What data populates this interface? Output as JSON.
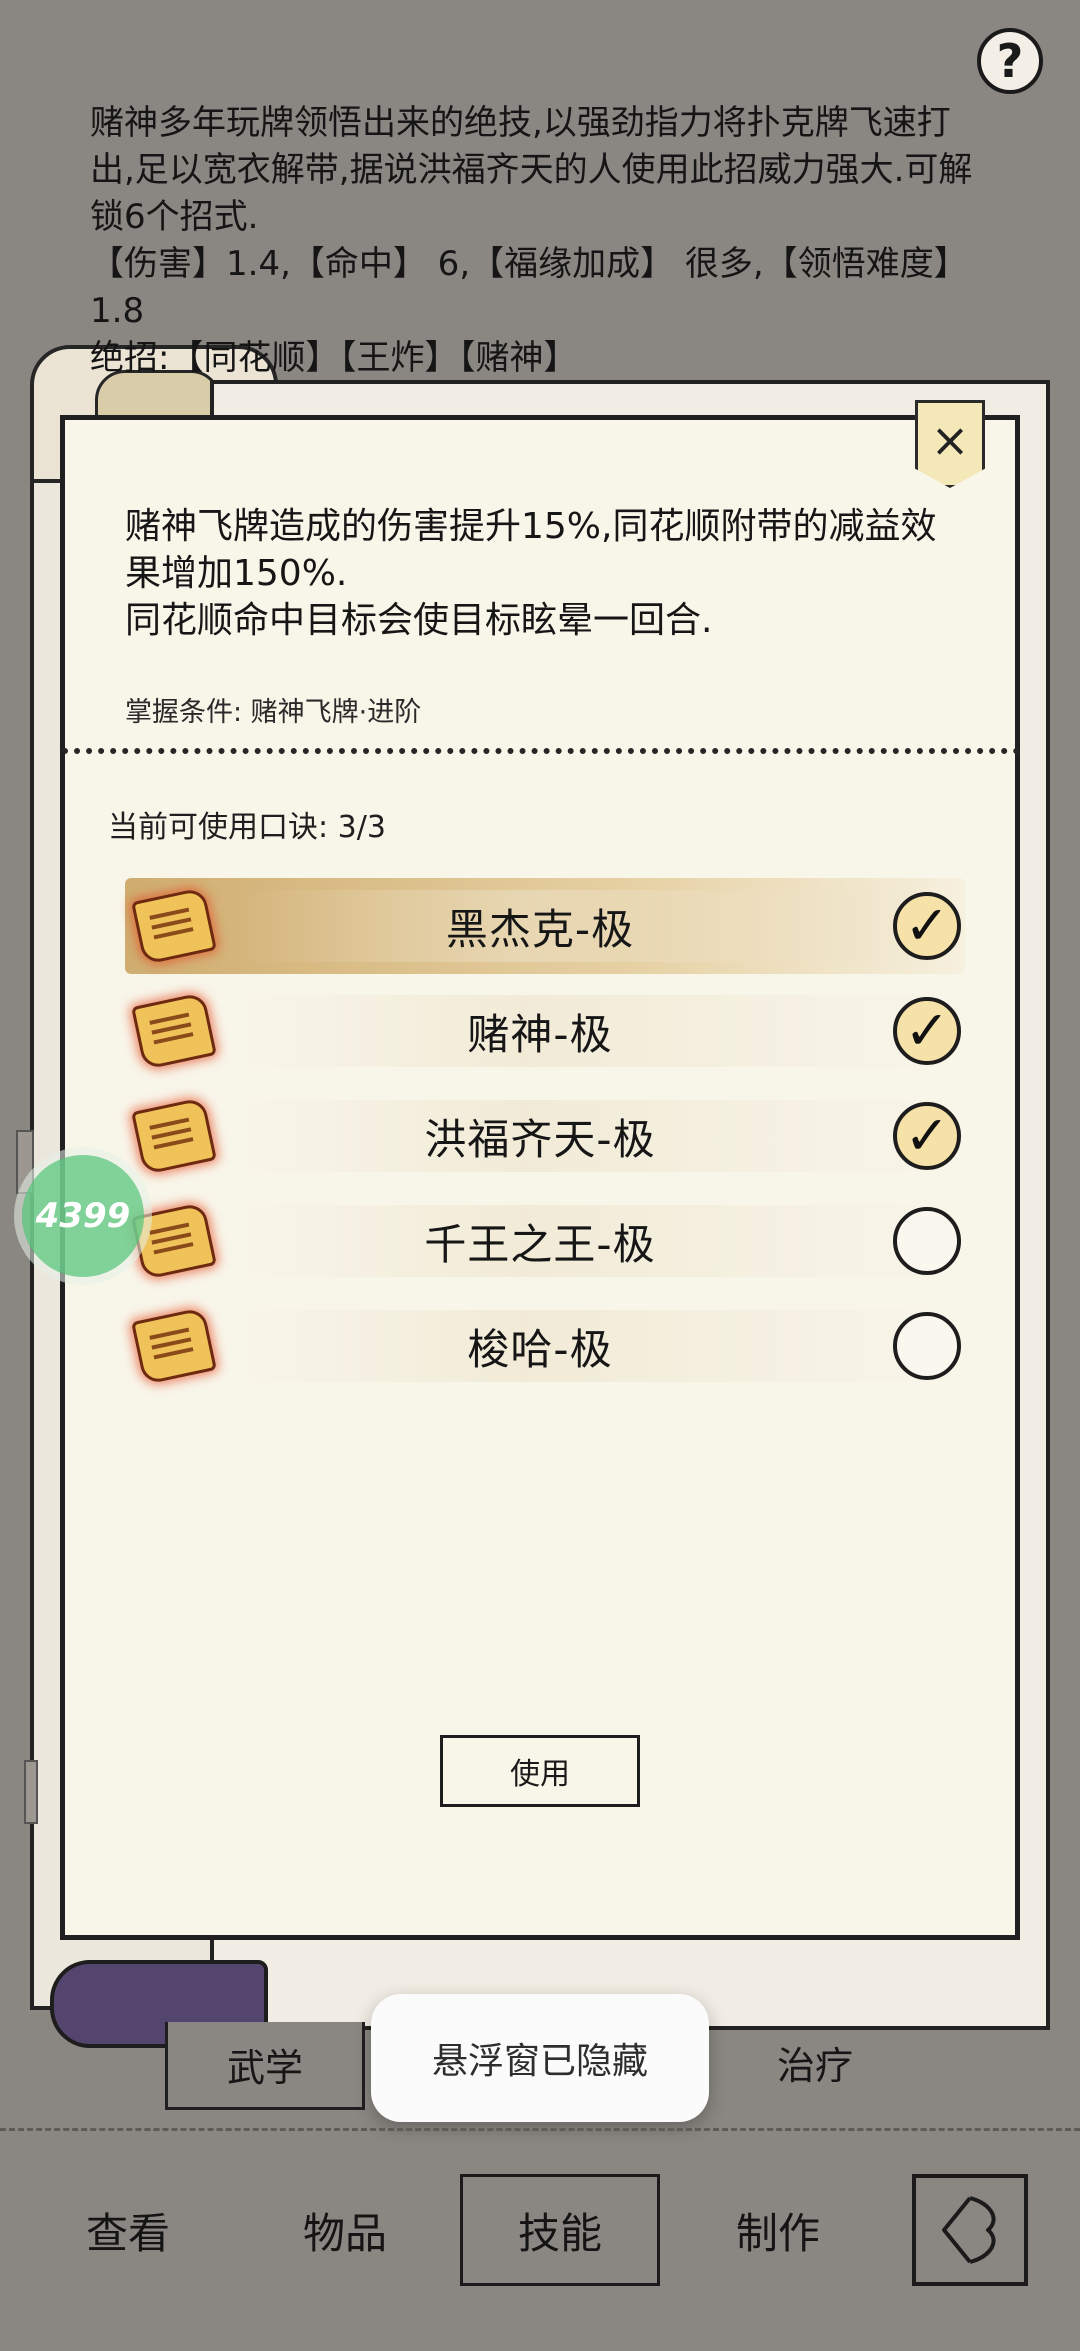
{
  "help": {
    "glyph": "?"
  },
  "skill": {
    "description": "赌神多年玩牌领悟出来的绝技,以强劲指力将扑克牌飞速打出,足以宽衣解带,据说洪福齐天的人使用此招威力强大.可解锁6个招式.",
    "stats": "【伤害】1.4,【命中】 6,【福缘加成】 很多,【领悟难度】1.8",
    "ultimates": "绝招:【同花顺】【王炸】【赌神】"
  },
  "popup": {
    "close_glyph": "×",
    "effect_line1": "赌神飞牌造成的伤害提升15%,同花顺附带的减益效果增加150%.",
    "effect_line2": "同花顺命中目标会使目标眩晕一回合.",
    "condition": "掌握条件: 赌神飞牌·进阶",
    "mantra_count": "当前可使用口诀: 3/3",
    "mantras": [
      {
        "name": "黑杰克-极",
        "checked": true,
        "selected": true
      },
      {
        "name": "赌神-极",
        "checked": true,
        "selected": false
      },
      {
        "name": "洪福齐天-极",
        "checked": true,
        "selected": false
      },
      {
        "name": "千王之王-极",
        "checked": false,
        "selected": false
      },
      {
        "name": "梭哈-极",
        "checked": false,
        "selected": false
      }
    ],
    "use_label": "使用",
    "check_glyph": "✓"
  },
  "badge": {
    "label": "4399"
  },
  "subtabs": {
    "martial": "武学",
    "heal": "治疗"
  },
  "toast": {
    "text": "悬浮窗已隐藏"
  },
  "bottom_nav": {
    "items": [
      {
        "label": "查看"
      },
      {
        "label": "物品"
      },
      {
        "label": "技能",
        "active": true
      },
      {
        "label": "制作"
      }
    ]
  },
  "colors": {
    "background": "#8a8782",
    "paper": "#f8f5e9",
    "highlight": "#d9b77a",
    "badge": "#6ecd8c"
  }
}
